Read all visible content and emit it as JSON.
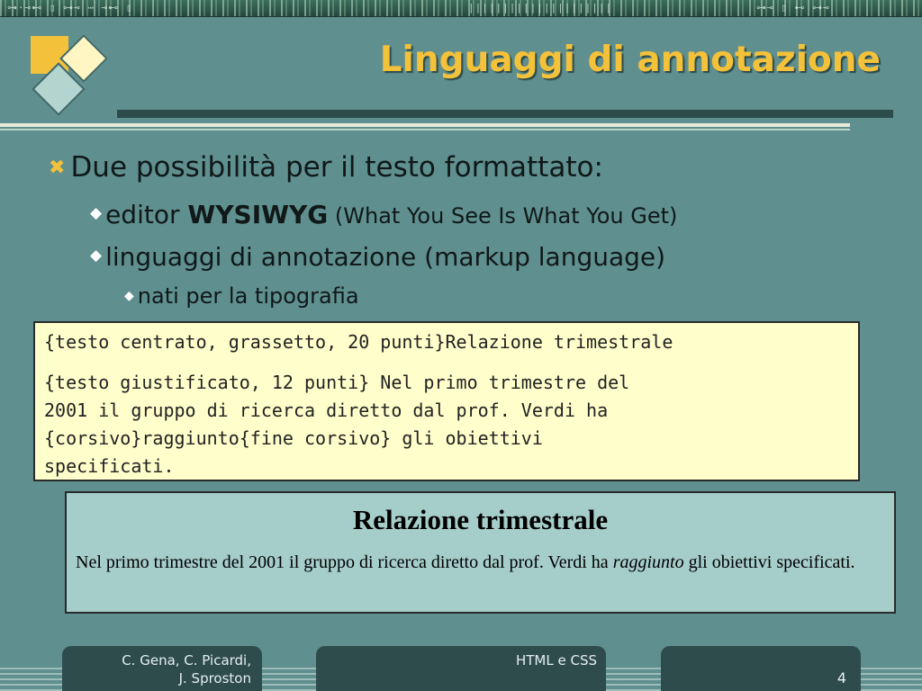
{
  "slide": {
    "title": "Linguaggi di annotazione",
    "bullets": {
      "level1": "Due possibilità per il testo formattato:",
      "editor_prefix": "editor ",
      "editor_bold": "WYSIWYG",
      "editor_paren": " (What You See Is What You Get)",
      "markup": "linguaggi di annotazione (markup language)",
      "typography": "nati per la tipografia"
    },
    "code_example": {
      "line1": "{testo centrato, grassetto, 20 punti}Relazione trimestrale",
      "line2": "{testo giustificato, 12 punti} Nel primo trimestre del",
      "line3": "2001 il gruppo di ricerca diretto dal prof. Verdi ha",
      "line4": "{corsivo}raggiunto{fine corsivo} gli obiettivi",
      "line5": "specificati."
    },
    "rendered_example": {
      "heading": "Relazione trimestrale",
      "body_before": "Nel primo trimestre del 2001 il gruppo di ricerca diretto dal prof. Verdi ha ",
      "body_italic": "raggiunto",
      "body_after": " gli obiettivi specificati."
    }
  },
  "footer": {
    "authors_line1": "C. Gena, C. Picardi,",
    "authors_line2": "J. Sproston",
    "course": "HTML e CSS",
    "page_number": "4"
  },
  "icons": {
    "level1_bullet": "cross-bullet-icon",
    "level2_bullet": "diamond-bullet-icon",
    "logo": "diamond-logo-icon"
  },
  "colors": {
    "background": "#5f8f8f",
    "title": "#f4c13a",
    "code_box": "#ffffcc",
    "render_box": "#a5cdc9",
    "footer": "#2e4c4c"
  }
}
